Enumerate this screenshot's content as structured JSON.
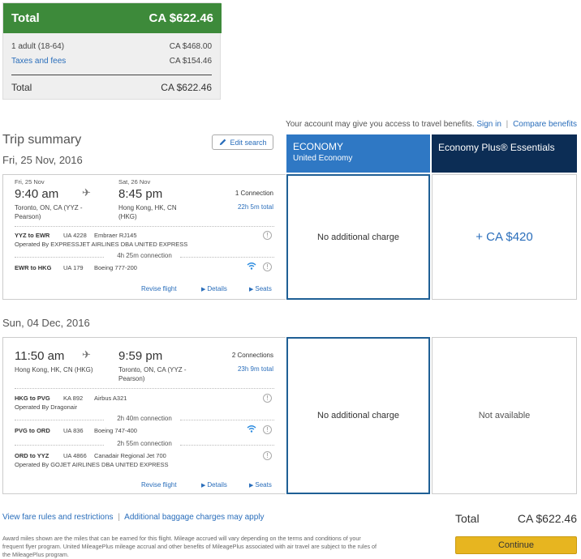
{
  "price": {
    "total_label": "Total",
    "total_value": "CA $622.46",
    "adult_label": "1 adult (18-64)",
    "adult_value": "CA $468.00",
    "taxes_label": "Taxes and fees",
    "taxes_value": "CA $154.46",
    "sum_label": "Total",
    "sum_value": "CA $622.46"
  },
  "benefits": {
    "text": "Your account may give you access to travel benefits.",
    "sign_in": "Sign in",
    "compare": "Compare benefits"
  },
  "trip": {
    "title": "Trip summary",
    "edit_search": "Edit search"
  },
  "columns": {
    "economy": "ECONOMY",
    "economy_sub": "United Economy",
    "plus": "Economy Plus® Essentials"
  },
  "outbound": {
    "date": "Fri, 25 Nov, 2016",
    "dep_date": "Fri, 25 Nov",
    "dep_time": "9:40 am",
    "dep_city": "Toronto, ON, CA (YYZ - Pearson)",
    "arr_date": "Sat, 26 Nov",
    "arr_time": "8:45 pm",
    "arr_city": "Hong Kong, HK, CN (HKG)",
    "connections": "1 Connection",
    "duration": "22h 5m total",
    "segments": [
      {
        "route": "YYZ to EWR",
        "flight": "UA 4228",
        "aircraft": "Embraer RJ145",
        "operator": "Operated By EXPRESSJET AIRLINES DBA UNITED EXPRESS"
      },
      {
        "route": "EWR to HKG",
        "flight": "UA 179",
        "aircraft": "Boeing 777-200",
        "operator": ""
      }
    ],
    "layovers": [
      "4h 25m connection"
    ],
    "revise": "Revise flight",
    "details": "Details",
    "seats": "Seats",
    "economy_cell": "No additional charge",
    "plus_cell": "+ CA $420"
  },
  "return": {
    "date": "Sun, 04 Dec, 2016",
    "dep_time": "11:50 am",
    "dep_city": "Hong Kong, HK, CN (HKG)",
    "arr_time": "9:59 pm",
    "arr_city": "Toronto, ON, CA (YYZ - Pearson)",
    "connections": "2 Connections",
    "duration": "23h 9m total",
    "segments": [
      {
        "route": "HKG to PVG",
        "flight": "KA 892",
        "aircraft": "Airbus A321",
        "operator": "Operated By Dragonair"
      },
      {
        "route": "PVG to ORD",
        "flight": "UA 836",
        "aircraft": "Boeing 747-400",
        "operator": ""
      },
      {
        "route": "ORD to YYZ",
        "flight": "UA 4866",
        "aircraft": "Canadair Regional Jet 700",
        "operator": "Operated By GOJET AIRLINES DBA UNITED EXPRESS"
      }
    ],
    "layovers": [
      "2h 40m connection",
      "2h 55m connection"
    ],
    "revise": "Revise flight",
    "details": "Details",
    "seats": "Seats",
    "economy_cell": "No additional charge",
    "plus_cell": "Not available"
  },
  "footer": {
    "fare_rules": "View fare rules and restrictions",
    "baggage": "Additional baggage charges may apply",
    "disclaimer": "Award miles shown are the miles that can be earned for this flight. Mileage accrued will vary depending on the terms and conditions of your frequent flyer program. United MileagePlus mileage accrual and other benefits of MileagePlus associated with air travel are subject to the rules of the MileagePlus program.",
    "total_label": "Total",
    "total_value": "CA $622.46",
    "continue": "Continue"
  },
  "colors": {
    "total_green": "#3d8a3a",
    "economy_blue": "#2f78c4",
    "plus_navy": "#0c2d55",
    "link_blue": "#2a6ebb",
    "continue_gold": "#e7b520"
  },
  "icons": [
    "pencil-icon",
    "plane-icon",
    "info-icon",
    "wifi-icon",
    "triangle-right-icon"
  ]
}
